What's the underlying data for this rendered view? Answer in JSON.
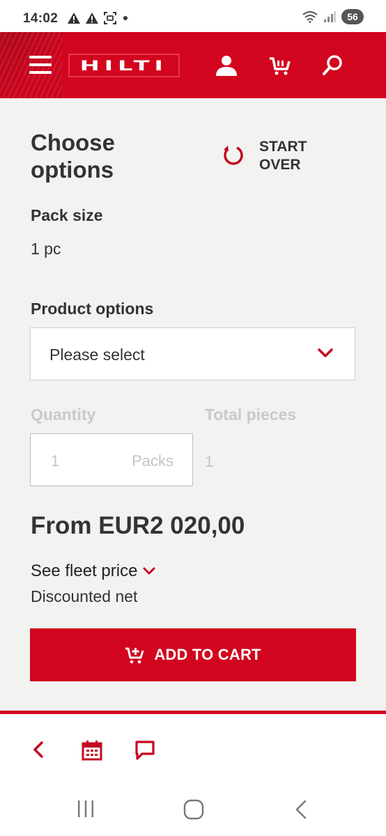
{
  "status_bar": {
    "time": "14:02",
    "battery": "56"
  },
  "header": {
    "logo": "HILTI",
    "icons": [
      "menu-icon",
      "user-icon",
      "cart-icon",
      "search-icon"
    ],
    "brand_color": "#d2051e"
  },
  "options": {
    "title": "Choose options",
    "start_over": "START OVER",
    "pack_size_label": "Pack size",
    "pack_size_value": "1 pc",
    "product_options_label": "Product options",
    "product_options_placeholder": "Please select",
    "quantity_label": "Quantity",
    "total_pieces_label": "Total pieces",
    "quantity_value": "1",
    "quantity_unit": "Packs",
    "total_pieces_value": "1",
    "price": "From EUR2 020,00",
    "fleet_price": "See fleet price",
    "discounted_net": "Discounted net",
    "add_to_cart": "ADD TO CART"
  },
  "toolbar": {
    "icons": [
      "back-icon",
      "calendar-icon",
      "comment-icon"
    ]
  },
  "nav": {
    "icons": [
      "recent-apps-icon",
      "home-icon",
      "back-nav-icon"
    ]
  }
}
